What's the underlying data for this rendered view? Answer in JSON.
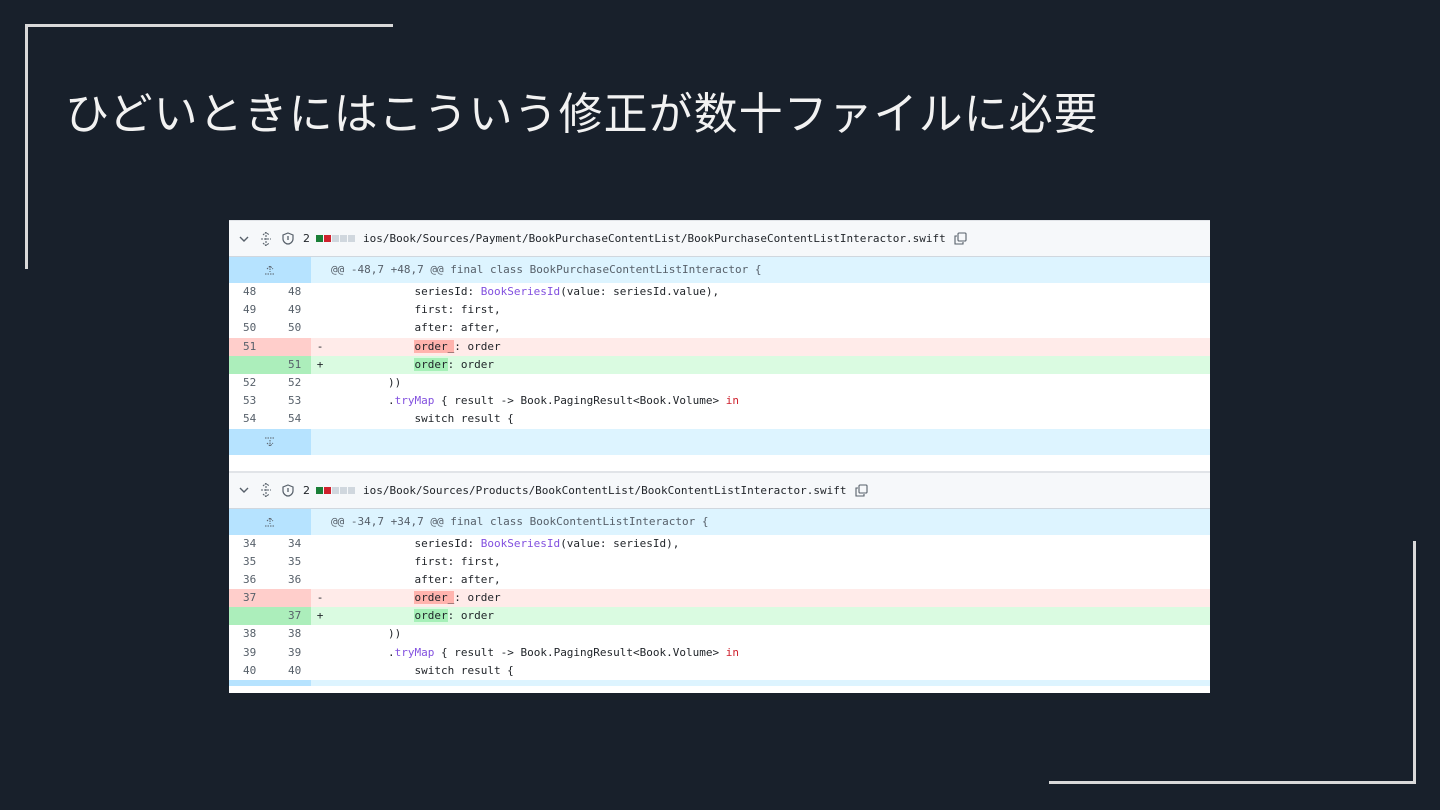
{
  "slide": {
    "title": "ひどいときにはこういう修正が数十ファイルに必要"
  },
  "files": [
    {
      "count": "2",
      "path": "ios/Book/Sources/Payment/BookPurchaseContentList/BookPurchaseContentListInteractor.swift",
      "hunk": "@@ -48,7 +48,7 @@ final class BookPurchaseContentListInteractor {",
      "lines": [
        {
          "type": "ctx",
          "old": "48",
          "new": "48",
          "pre": "            seriesId: ",
          "typ": "BookSeriesId",
          "post": "(value: seriesId.value),"
        },
        {
          "type": "ctx",
          "old": "49",
          "new": "49",
          "pre": "            first: first,"
        },
        {
          "type": "ctx",
          "old": "50",
          "new": "50",
          "pre": "            after: after,"
        },
        {
          "type": "del",
          "old": "51",
          "new": "",
          "sign": "-",
          "pre": "            ",
          "hl": "order_",
          "post": ": order"
        },
        {
          "type": "add",
          "old": "",
          "new": "51",
          "sign": "+",
          "pre": "            ",
          "hl": "order",
          "post": ": order"
        },
        {
          "type": "ctx",
          "old": "52",
          "new": "52",
          "pre": "        ))"
        },
        {
          "type": "ctx",
          "old": "53",
          "new": "53",
          "pre": "        .",
          "fn": "tryMap",
          "post": " { result -> Book.PagingResult<Book.Volume> ",
          "kw": "in"
        },
        {
          "type": "ctx",
          "old": "54",
          "new": "54",
          "pre": "            switch result {"
        }
      ]
    },
    {
      "count": "2",
      "path": "ios/Book/Sources/Products/BookContentList/BookContentListInteractor.swift",
      "hunk": "@@ -34,7 +34,7 @@ final class BookContentListInteractor {",
      "lines": [
        {
          "type": "ctx",
          "old": "34",
          "new": "34",
          "pre": "            seriesId: ",
          "typ": "BookSeriesId",
          "post": "(value: seriesId),"
        },
        {
          "type": "ctx",
          "old": "35",
          "new": "35",
          "pre": "            first: first,"
        },
        {
          "type": "ctx",
          "old": "36",
          "new": "36",
          "pre": "            after: after,"
        },
        {
          "type": "del",
          "old": "37",
          "new": "",
          "sign": "-",
          "pre": "            ",
          "hl": "order_",
          "post": ": order"
        },
        {
          "type": "add",
          "old": "",
          "new": "37",
          "sign": "+",
          "pre": "            ",
          "hl": "order",
          "post": ": order"
        },
        {
          "type": "ctx",
          "old": "38",
          "new": "38",
          "pre": "        ))"
        },
        {
          "type": "ctx",
          "old": "39",
          "new": "39",
          "pre": "        .",
          "fn": "tryMap",
          "post": " { result -> Book.PagingResult<Book.Volume> ",
          "kw": "in"
        },
        {
          "type": "ctx",
          "old": "40",
          "new": "40",
          "pre": "            switch result {"
        }
      ]
    }
  ],
  "colors": {
    "bg": "#18202b",
    "del": "#ffebe9",
    "add": "#dafbe1",
    "hunk": "#ddf4ff"
  },
  "icons": [
    "chevron-down-icon",
    "expand-icon",
    "shield-icon",
    "copy-icon",
    "expand-up-icon",
    "expand-down-icon"
  ]
}
